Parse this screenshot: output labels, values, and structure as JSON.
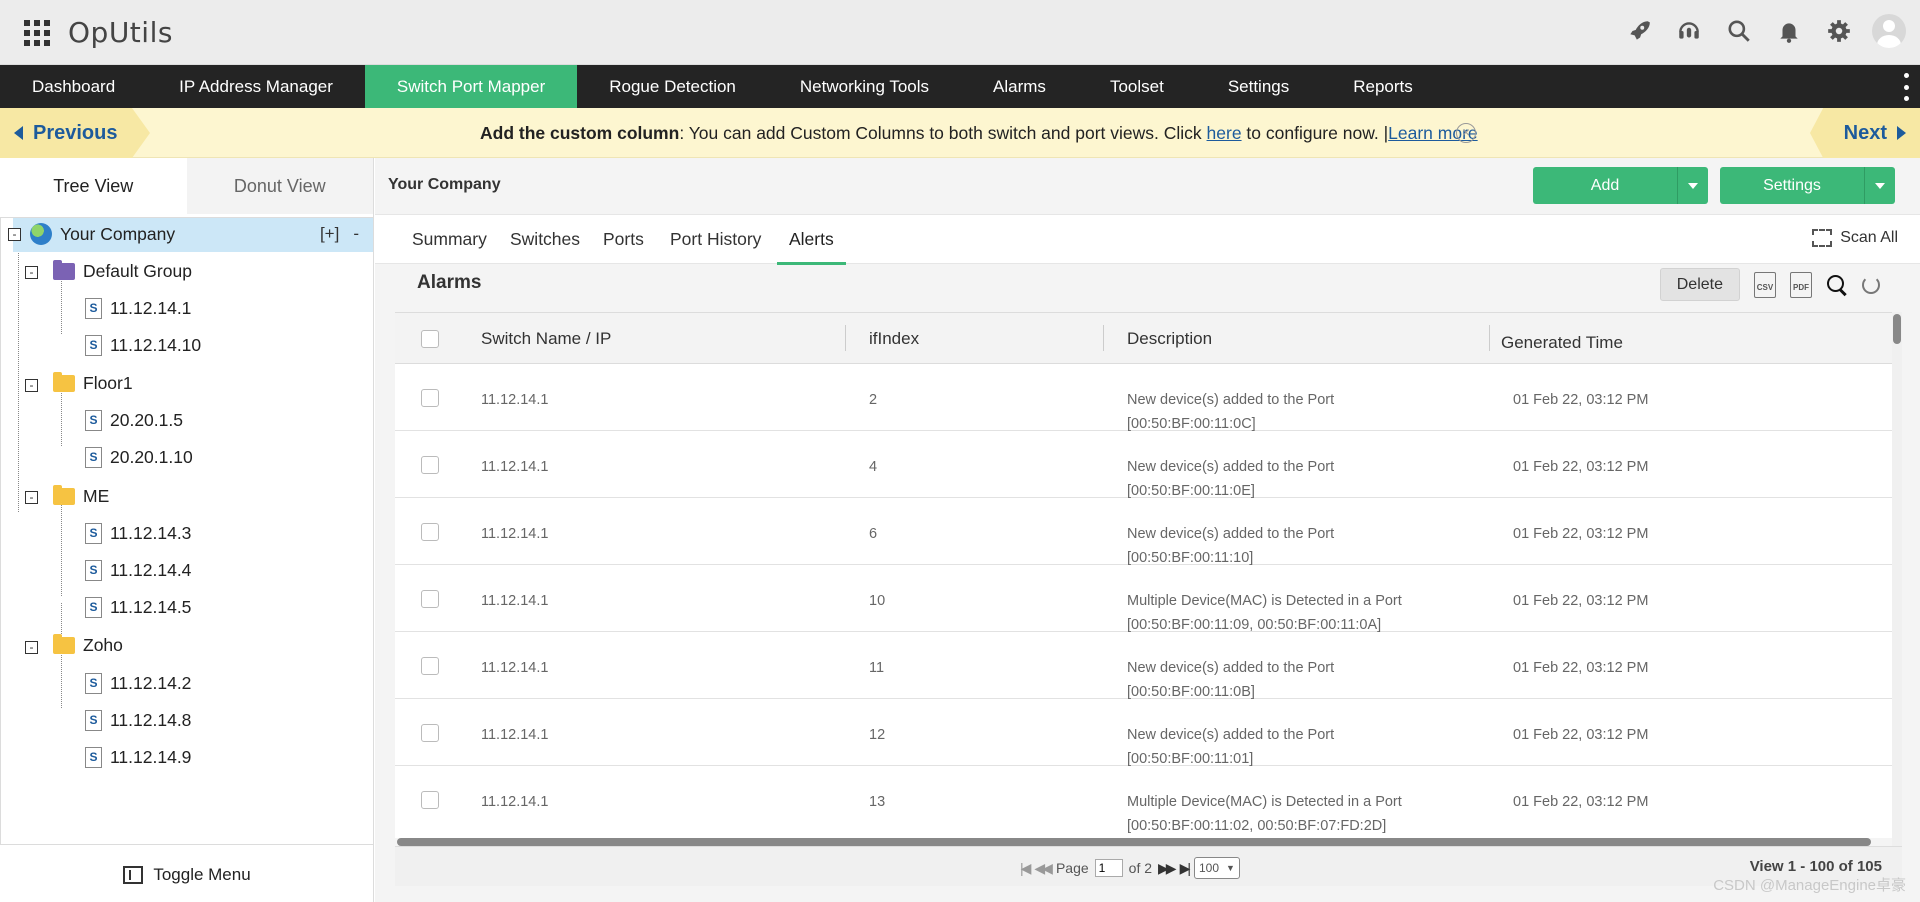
{
  "app": {
    "title": "OpUtils"
  },
  "nav": {
    "items": [
      {
        "label": "Dashboard"
      },
      {
        "label": "IP Address Manager"
      },
      {
        "label": "Switch Port Mapper",
        "active": true
      },
      {
        "label": "Rogue Detection"
      },
      {
        "label": "Networking Tools"
      },
      {
        "label": "Alarms"
      },
      {
        "label": "Toolset"
      },
      {
        "label": "Settings"
      },
      {
        "label": "Reports"
      }
    ]
  },
  "banner": {
    "prev": "Previous",
    "next": "Next",
    "title": "Add the custom column",
    "text": ": You can add Custom Columns to both switch and port views. Click ",
    "here": "here",
    "text2": " to configure now. |",
    "learn_more": "Learn more"
  },
  "left": {
    "tabs": [
      "Tree View",
      "Donut View"
    ],
    "root": "Your Company",
    "root_expand": "[+]",
    "root_collapse": "-",
    "toggle_symbol": "-",
    "switch_glyph": "S",
    "groups": [
      {
        "name": "Default Group",
        "icon": "purple-folder-icon",
        "devices": [
          "11.12.14.1",
          "11.12.14.10"
        ]
      },
      {
        "name": "Floor1",
        "icon": "yellow-folder-icon",
        "devices": [
          "20.20.1.5",
          "20.20.1.10"
        ]
      },
      {
        "name": "ME",
        "icon": "yellow-folder-icon",
        "devices": [
          "11.12.14.3",
          "11.12.14.4",
          "11.12.14.5"
        ]
      },
      {
        "name": "Zoho",
        "icon": "yellow-folder-icon",
        "devices": [
          "11.12.14.2",
          "11.12.14.8",
          "11.12.14.9"
        ]
      }
    ],
    "toggle_menu": "Toggle Menu"
  },
  "right": {
    "breadcrumb": "Your Company",
    "add_label": "Add",
    "settings_label": "Settings",
    "subtabs": [
      "Summary",
      "Switches",
      "Ports",
      "Port History",
      "Alerts"
    ],
    "active_subtab": "Alerts",
    "scan_all": "Scan All",
    "grid_title": "Alarms",
    "delete_label": "Delete",
    "csv_label": "CSV",
    "pdf_label": "PDF"
  },
  "table": {
    "columns": [
      "Switch Name / IP",
      "ifIndex",
      "Description",
      "Generated Time"
    ],
    "rows": [
      {
        "switch": "11.12.14.1",
        "ifindex": "2",
        "desc1": "New device(s) added to the Port",
        "desc2": "[00:50:BF:00:11:0C]",
        "time": "01 Feb 22, 03:12 PM"
      },
      {
        "switch": "11.12.14.1",
        "ifindex": "4",
        "desc1": "New device(s) added to the Port",
        "desc2": "[00:50:BF:00:11:0E]",
        "time": "01 Feb 22, 03:12 PM"
      },
      {
        "switch": "11.12.14.1",
        "ifindex": "6",
        "desc1": "New device(s) added to the Port",
        "desc2": "[00:50:BF:00:11:10]",
        "time": "01 Feb 22, 03:12 PM"
      },
      {
        "switch": "11.12.14.1",
        "ifindex": "10",
        "desc1": "Multiple Device(MAC) is Detected in a Port",
        "desc2": "[00:50:BF:00:11:09, 00:50:BF:00:11:0A]",
        "time": "01 Feb 22, 03:12 PM"
      },
      {
        "switch": "11.12.14.1",
        "ifindex": "11",
        "desc1": "New device(s) added to the Port",
        "desc2": "[00:50:BF:00:11:0B]",
        "time": "01 Feb 22, 03:12 PM"
      },
      {
        "switch": "11.12.14.1",
        "ifindex": "12",
        "desc1": "New device(s) added to the Port",
        "desc2": "[00:50:BF:00:11:01]",
        "time": "01 Feb 22, 03:12 PM"
      },
      {
        "switch": "11.12.14.1",
        "ifindex": "13",
        "desc1": "Multiple Device(MAC) is Detected in a Port",
        "desc2": "[00:50:BF:00:11:02, 00:50:BF:07:FD:2D]",
        "time": "01 Feb 22, 03:12 PM"
      }
    ]
  },
  "pager": {
    "page_label": "Page",
    "page_value": "1",
    "of_label": "of 2",
    "per_page": "100",
    "summary": "View 1 - 100 of 105"
  },
  "watermark": "CSDN @ManageEngine卓豪",
  "colors": {
    "accent": "#3cb878",
    "nav_bg": "#242424",
    "banner_bg": "#fdf6d0",
    "link": "#1d5b9c",
    "tree_selected": "#cce7f7"
  },
  "icons": [
    "apps-grid-icon",
    "rocket-icon",
    "headset-icon",
    "search-icon",
    "bell-icon",
    "gear-icon",
    "user-avatar-icon"
  ]
}
